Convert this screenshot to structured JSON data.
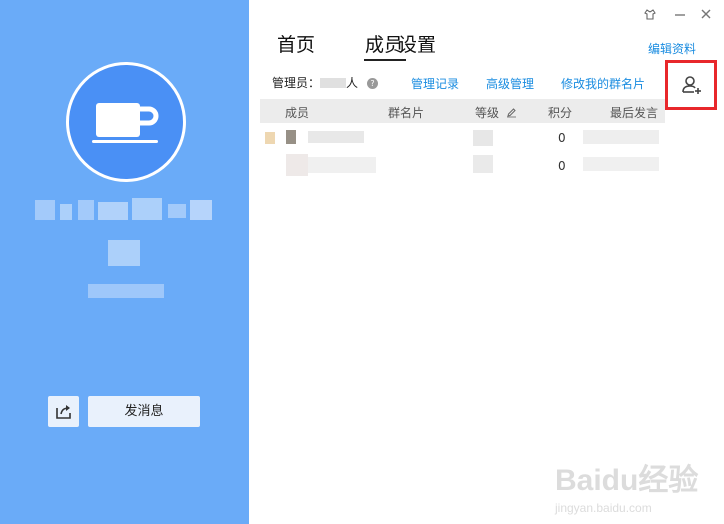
{
  "window": {
    "skin_icon": "shirt-icon",
    "minimize_icon": "minimize-icon",
    "close_icon": "close-icon"
  },
  "profile": {
    "avatar_icon": "coffee-cup-icon",
    "share_icon": "share-icon",
    "send_message": "发消息"
  },
  "tabs": [
    {
      "label": "首页"
    },
    {
      "label": "成员"
    },
    {
      "label": "设置"
    }
  ],
  "edit_profile": "编辑资料",
  "admin": {
    "prefix": "管理员：",
    "suffix": "人",
    "help": "?"
  },
  "links": {
    "management_log": "管理记录",
    "advanced_management": "高级管理",
    "edit_my_card": "修改我的群名片"
  },
  "add_member_icon": "add-member-icon",
  "table": {
    "columns": [
      "成员",
      "群名片",
      "等级",
      "积分",
      "最后发言"
    ],
    "edit_level_icon": "pencil-icon",
    "rows": [
      {
        "points": "0"
      },
      {
        "points": "0"
      }
    ]
  },
  "watermark": {
    "logo": "Baidu经验",
    "url": "jingyan.baidu.com"
  },
  "colors": {
    "left_panel": "#6aabf8",
    "avatar_bg": "#4a90f5",
    "link": "#1a8ce0",
    "highlight_box": "#e8272b"
  }
}
